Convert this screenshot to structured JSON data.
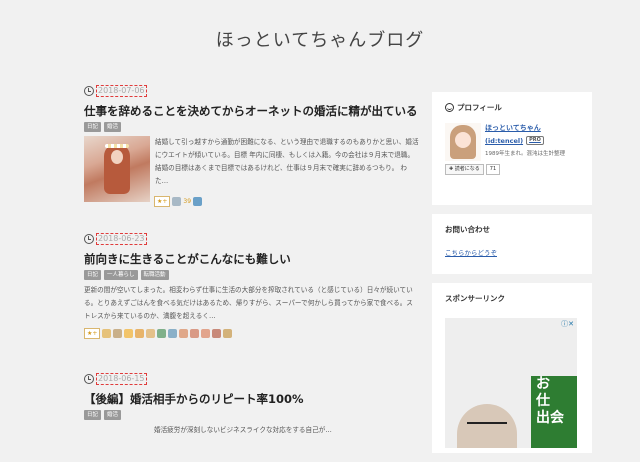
{
  "blog": {
    "title": "ほっといてちゃんブログ"
  },
  "entries": [
    {
      "date": "2018-07-06",
      "title": "仕事を辞めることを決めてからオーネットの婚活に精が出ている",
      "categories": [
        "日記",
        "婚活"
      ],
      "excerpt": "結婚して引っ越すから通勤が困難になる、という理由で退職するのもありかと思い、婚活にウエイトが傾いている。目標 年内に同棲、もしくは入籍。今の会社は９月末で退職。結婚の目標はあくまで目標ではあるけれど、仕事は９月末で確実に辞めるつもり。 わた…",
      "star_label": "★+",
      "star_count": "39"
    },
    {
      "date": "2018-06-23",
      "title": "前向きに生きることがこんなにも難しい",
      "categories": [
        "日記",
        "一人暮らし",
        "転職活動"
      ],
      "excerpt": "更新の間が空いてしまった。相変わらず仕事に生活の大部分を搾取されている（と感じている）日々が続いている。とりあえずごはんを食べる気だけはあるため、帰りすがら、スーパーで何かしら買ってから家で食べる。ストレスから来ているのか、満腹を超えるく…",
      "star_label": "★+"
    },
    {
      "date": "2018-06-15",
      "title": "【後編】婚活相手からのリピート率100%",
      "categories": [
        "日記",
        "婚活"
      ],
      "excerpt": "婚活疲労が深刻しないビジネスライクな対応をする自己が…"
    }
  ],
  "sidebar": {
    "profile": {
      "heading": "プロフィール",
      "name": "ほっといてちゃん",
      "id": "(id:tencel)",
      "badge": "PRO",
      "desc": "1989年生まれ。混沌は生計整理",
      "follow_label": "読者になる",
      "follow_count": "71"
    },
    "contact": {
      "heading": "お問い合わせ",
      "link": "こちらからどうぞ"
    },
    "sponsor": {
      "heading": "スポンサーリンク",
      "ad_text": [
        "お",
        "仕",
        "出会"
      ]
    }
  },
  "colors": {
    "link": "#2a5caa",
    "date_border": "#e03b3b",
    "background": "#f1f1f1"
  }
}
